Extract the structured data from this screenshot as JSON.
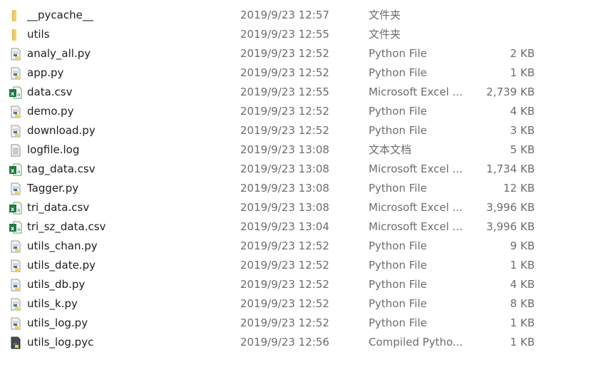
{
  "files": [
    {
      "name": "__pycache__",
      "date": "2019/9/23 12:57",
      "type": "文件夹",
      "size": "",
      "icon": "folder-icon"
    },
    {
      "name": "utils",
      "date": "2019/9/23 12:55",
      "type": "文件夹",
      "size": "",
      "icon": "folder-icon"
    },
    {
      "name": "analy_all.py",
      "date": "2019/9/23 12:52",
      "type": "Python File",
      "size": "2 KB",
      "icon": "python-file-icon"
    },
    {
      "name": "app.py",
      "date": "2019/9/23 12:52",
      "type": "Python File",
      "size": "1 KB",
      "icon": "python-file-icon"
    },
    {
      "name": "data.csv",
      "date": "2019/9/23 12:55",
      "type": "Microsoft Excel ...",
      "size": "2,739 KB",
      "icon": "excel-file-icon"
    },
    {
      "name": "demo.py",
      "date": "2019/9/23 12:52",
      "type": "Python File",
      "size": "4 KB",
      "icon": "python-file-icon"
    },
    {
      "name": "download.py",
      "date": "2019/9/23 12:52",
      "type": "Python File",
      "size": "3 KB",
      "icon": "python-file-icon"
    },
    {
      "name": "logfile.log",
      "date": "2019/9/23 13:08",
      "type": "文本文档",
      "size": "5 KB",
      "icon": "text-file-icon"
    },
    {
      "name": "tag_data.csv",
      "date": "2019/9/23 13:08",
      "type": "Microsoft Excel ...",
      "size": "1,734 KB",
      "icon": "excel-file-icon"
    },
    {
      "name": "Tagger.py",
      "date": "2019/9/23 13:08",
      "type": "Python File",
      "size": "12 KB",
      "icon": "python-file-icon"
    },
    {
      "name": "tri_data.csv",
      "date": "2019/9/23 13:08",
      "type": "Microsoft Excel ...",
      "size": "3,996 KB",
      "icon": "excel-file-icon"
    },
    {
      "name": "tri_sz_data.csv",
      "date": "2019/9/23 13:04",
      "type": "Microsoft Excel ...",
      "size": "3,996 KB",
      "icon": "excel-file-icon"
    },
    {
      "name": "utils_chan.py",
      "date": "2019/9/23 12:52",
      "type": "Python File",
      "size": "9 KB",
      "icon": "python-file-icon"
    },
    {
      "name": "utils_date.py",
      "date": "2019/9/23 12:52",
      "type": "Python File",
      "size": "1 KB",
      "icon": "python-file-icon"
    },
    {
      "name": "utils_db.py",
      "date": "2019/9/23 12:52",
      "type": "Python File",
      "size": "4 KB",
      "icon": "python-file-icon"
    },
    {
      "name": "utils_k.py",
      "date": "2019/9/23 12:52",
      "type": "Python File",
      "size": "8 KB",
      "icon": "python-file-icon"
    },
    {
      "name": "utils_log.py",
      "date": "2019/9/23 12:52",
      "type": "Python File",
      "size": "1 KB",
      "icon": "python-file-icon"
    },
    {
      "name": "utils_log.pyc",
      "date": "2019/9/23 12:56",
      "type": "Compiled Pytho...",
      "size": "1 KB",
      "icon": "compiled-python-file-icon"
    }
  ]
}
